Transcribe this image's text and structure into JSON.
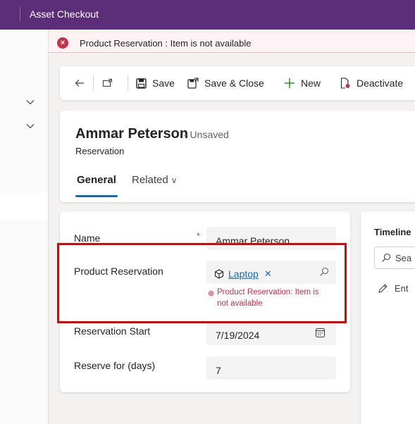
{
  "app": {
    "title": "Asset Checkout"
  },
  "notification": {
    "message": "Product Reservation : Item is not available"
  },
  "commandbar": {
    "save_label": "Save",
    "save_close_label": "Save & Close",
    "new_label": "New",
    "deactivate_label": "Deactivate"
  },
  "header": {
    "record_name": "Ammar Peterson",
    "status": "- Unsaved",
    "entity": "Reservation",
    "tabs": [
      {
        "label": "General",
        "selected": true
      },
      {
        "label": "Related",
        "selected": false
      }
    ]
  },
  "form": {
    "name": {
      "label": "Name",
      "required_marker": "*",
      "value": "Ammar Peterson"
    },
    "product_reservation": {
      "label": "Product Reservation",
      "value": "Laptop",
      "error_line1": "Product Reservation: Item is",
      "error_line2": "not available"
    },
    "reservation_start": {
      "label": "Reservation Start",
      "value": "7/19/2024"
    },
    "reserve_for": {
      "label": "Reserve for (days)",
      "value": "7"
    }
  },
  "timeline": {
    "title": "Timeline",
    "search_text": "Sea",
    "enter_text": "Ent"
  },
  "colors": {
    "brand": "#5c2d78",
    "error": "#c4314b",
    "link": "#0f6cbd",
    "highlight": "#e00000"
  }
}
